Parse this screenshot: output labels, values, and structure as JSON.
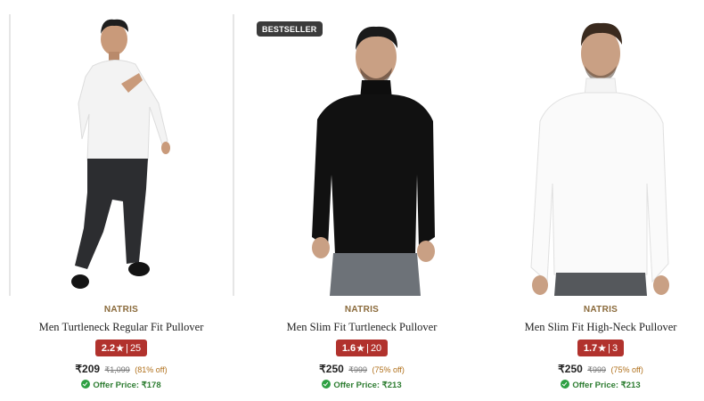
{
  "products": [
    {
      "badge": "",
      "brand": "NATRIS",
      "name": "Men Turtleneck Regular Fit Pullover",
      "rating": "2.2",
      "reviews": "25",
      "price": "₹209",
      "mrp": "₹1,099",
      "discount": "(81% off)",
      "offer_label": "Offer Price:",
      "offer_price": "₹178",
      "sweater_color": "#f3f3f3"
    },
    {
      "badge": "BESTSELLER",
      "brand": "NATRIS",
      "name": "Men Slim Fit Turtleneck Pullover",
      "rating": "1.6",
      "reviews": "20",
      "price": "₹250",
      "mrp": "₹999",
      "discount": "(75% off)",
      "offer_label": "Offer Price:",
      "offer_price": "₹213",
      "sweater_color": "#111111"
    },
    {
      "badge": "",
      "brand": "NATRIS",
      "name": "Men Slim Fit High-Neck Pullover",
      "rating": "1.7",
      "reviews": "3",
      "price": "₹250",
      "mrp": "₹999",
      "discount": "(75% off)",
      "offer_label": "Offer Price:",
      "offer_price": "₹213",
      "sweater_color": "#fafafa"
    }
  ],
  "colors": {
    "brand": "#8a6a3b",
    "rating_bg": "#b1322d",
    "offer": "#2e7d32",
    "badge_bg": "#3b3b3b"
  },
  "icons": {
    "rating": "star-icon",
    "offer": "offer-check-icon"
  }
}
